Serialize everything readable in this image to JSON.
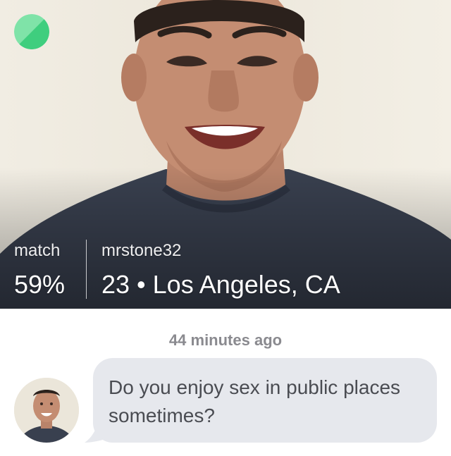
{
  "profile": {
    "match_label": "match",
    "match_value": "59%",
    "username": "mrstone32",
    "age": "23",
    "separator": "•",
    "location": "Los Angeles, CA",
    "user_info": "23 • Los Angeles, CA"
  },
  "conversation": {
    "timestamp": "44 minutes ago",
    "message": "Do you enjoy sex in public places sometimes?"
  },
  "icons": {
    "status": "online-status-icon",
    "avatar": "profile-avatar"
  },
  "colors": {
    "status_light": "#7fe3a8",
    "status_dark": "#3fce7e",
    "bubble_bg": "#e6e8ed",
    "bubble_text": "#4a4c52",
    "timestamp": "#8a8a8f"
  }
}
